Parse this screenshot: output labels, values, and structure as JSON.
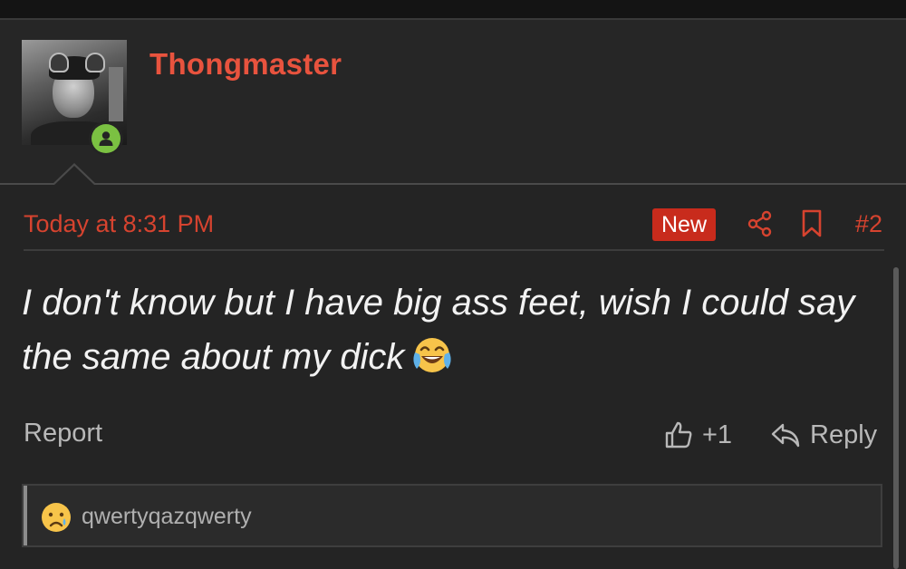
{
  "post": {
    "username": "Thongmaster",
    "timestamp": "Today at 8:31 PM",
    "badge": "New",
    "post_number": "#2",
    "message": "I don't know but I have big ass feet, wish I could say the same about my dick",
    "message_emoji": "face-with-tears-of-joy-icon",
    "online_status": "online"
  },
  "actions": {
    "report_label": "Report",
    "like_count": "+1",
    "reply_label": "Reply"
  },
  "reactions": {
    "emoji": "crying-face-icon",
    "users": "qwertyqazqwerty"
  },
  "colors": {
    "background": "#242424",
    "accent": "#e8533e",
    "new_badge": "#c82b1c",
    "online": "#7bc142",
    "muted_text": "#b8b8b8"
  }
}
